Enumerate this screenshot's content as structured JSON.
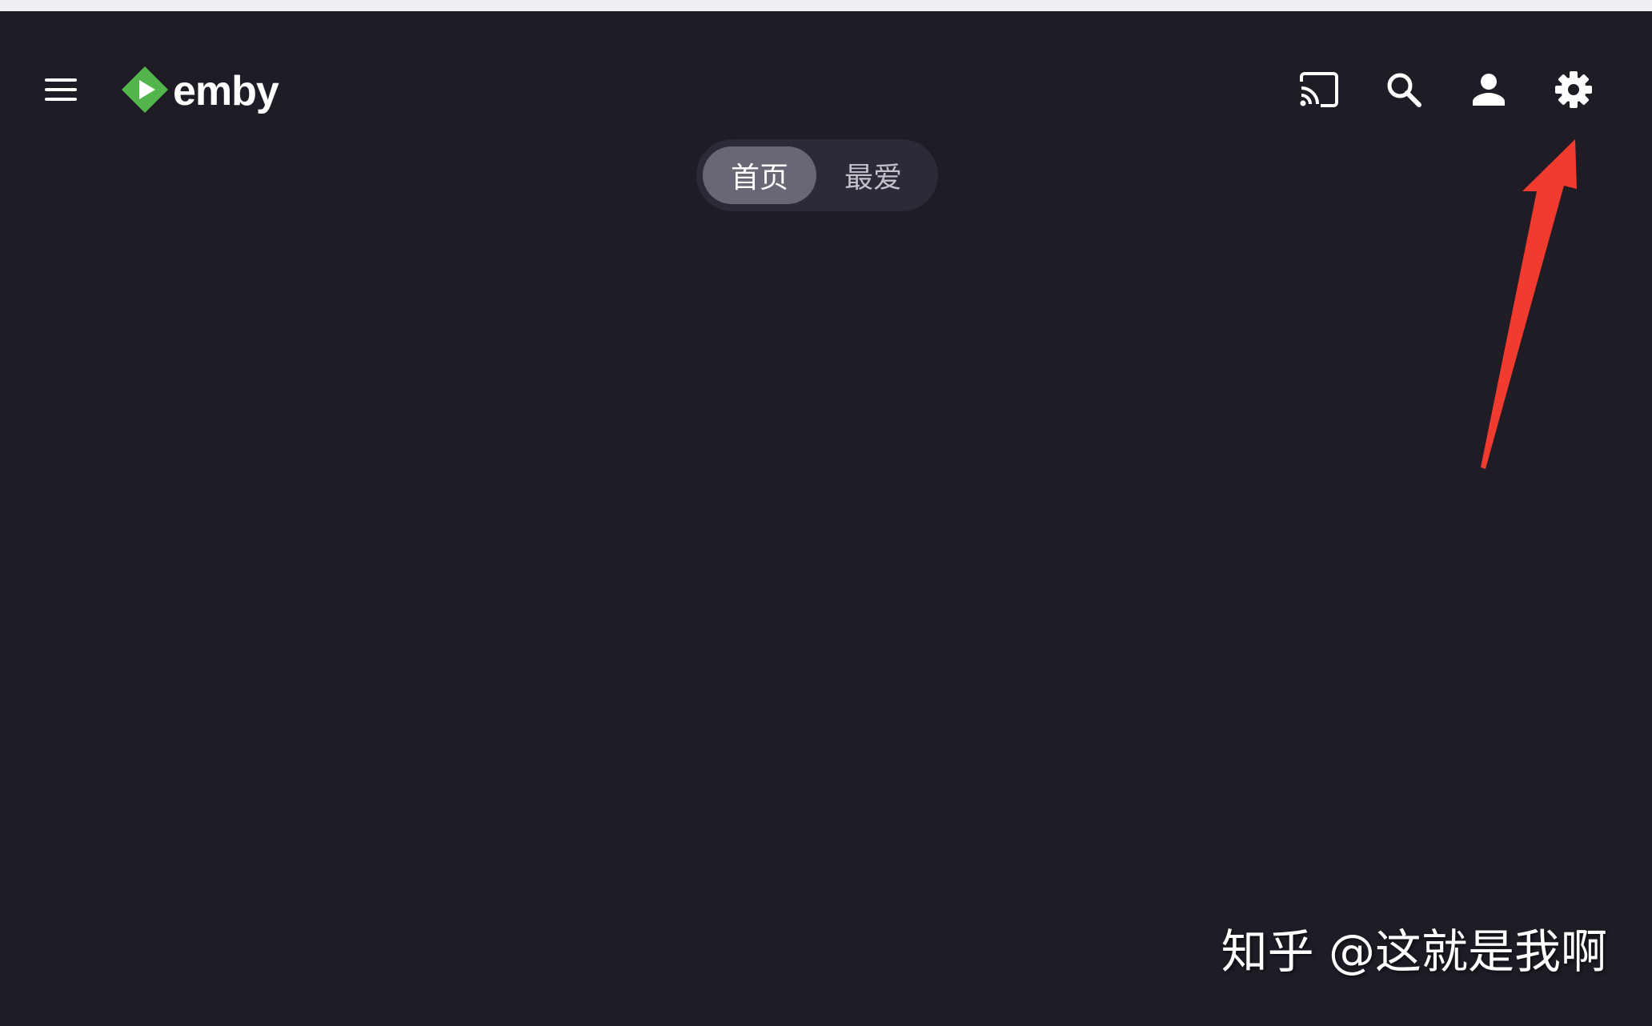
{
  "header": {
    "logo_text": "emby",
    "icons": [
      "menu-icon",
      "emby-logo-icon",
      "cast-icon",
      "search-icon",
      "user-icon",
      "gear-icon"
    ]
  },
  "tabs": [
    {
      "label": "首页",
      "active": true
    },
    {
      "label": "最爱",
      "active": false
    }
  ],
  "colors": {
    "background": "#1f1c26",
    "brand_green": "#52b54b",
    "annotation_arrow": "#f23b2f",
    "tab_active": "#6b6675",
    "tab_bar": "#2d2937"
  },
  "watermark": "知乎 @这就是我啊"
}
